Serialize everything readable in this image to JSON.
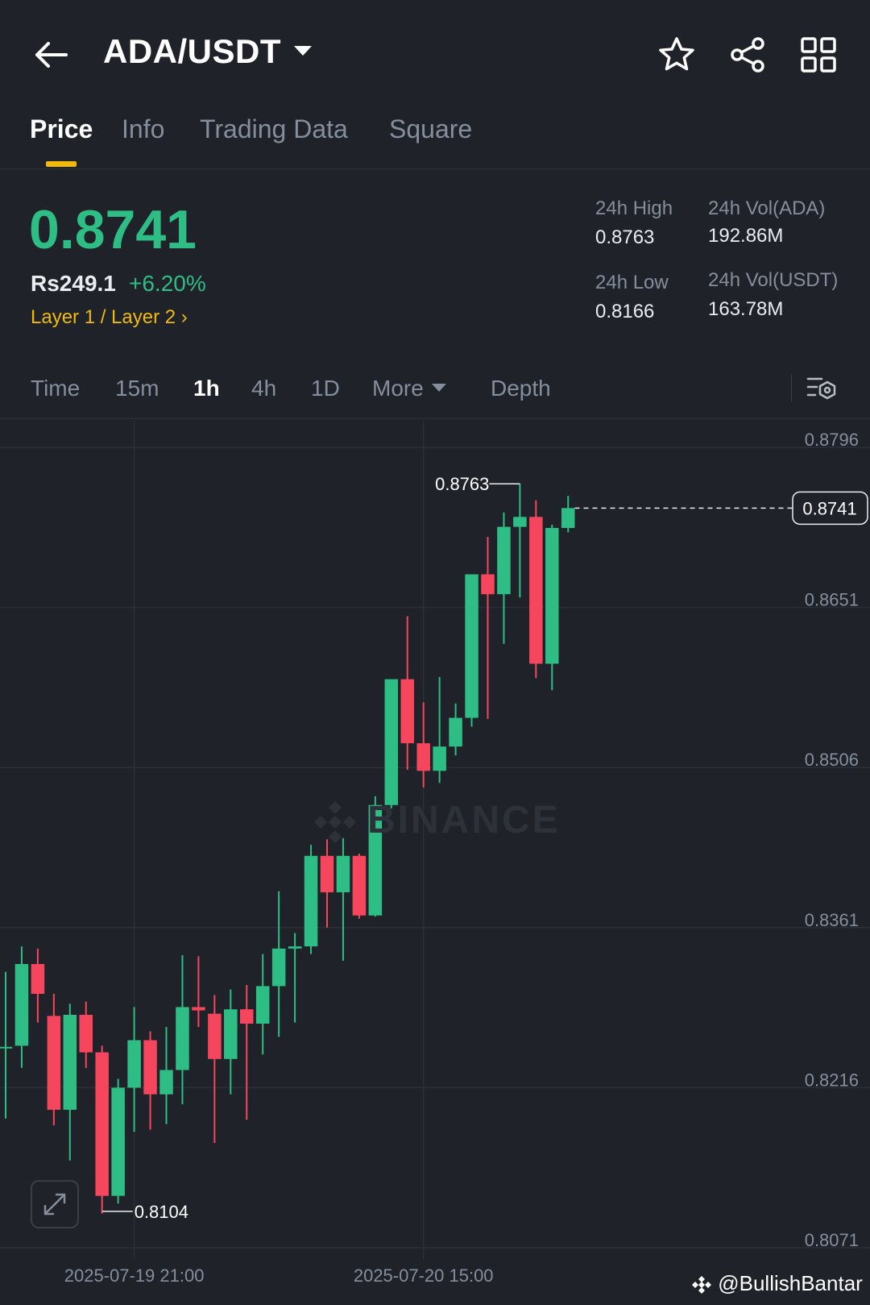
{
  "header": {
    "pair": "ADA/USDT",
    "icons": {
      "back": "arrow-left-icon",
      "favorite": "star-icon",
      "share": "share-icon",
      "menu": "grid-icon"
    }
  },
  "tabs": [
    {
      "label": "Price",
      "active": true
    },
    {
      "label": "Info",
      "active": false
    },
    {
      "label": "Trading Data",
      "active": false
    },
    {
      "label": "Square",
      "active": false
    }
  ],
  "ticker": {
    "last_price": "0.8741",
    "fiat_price": "Rs249.1",
    "change_pct": "+6.20%",
    "tag": "Layer 1 / Layer 2",
    "high_label": "24h High",
    "high_value": "0.8763",
    "low_label": "24h Low",
    "low_value": "0.8166",
    "vol_base_label": "24h Vol(ADA)",
    "vol_base_value": "192.86M",
    "vol_quote_label": "24h Vol(USDT)",
    "vol_quote_value": "163.78M"
  },
  "intervals": {
    "items": [
      {
        "label": "Time",
        "active": false
      },
      {
        "label": "15m",
        "active": false
      },
      {
        "label": "1h",
        "active": true
      },
      {
        "label": "4h",
        "active": false
      },
      {
        "label": "1D",
        "active": false
      }
    ],
    "more_label": "More",
    "depth_label": "Depth"
  },
  "colors": {
    "up": "#2ebd85",
    "down": "#f6465d",
    "accent": "#f0b90b",
    "background": "#1f2329"
  },
  "chart_data": {
    "type": "candlestick",
    "interval": "1h",
    "y_ticks": [
      0.8796,
      0.8651,
      0.8506,
      0.8361,
      0.8216,
      0.8071
    ],
    "ylim": [
      0.8071,
      0.8796
    ],
    "x_ticks": [
      "2025-07-19 21:00",
      "2025-07-20 15:00"
    ],
    "last_price_label": "0.8741",
    "high_marker": {
      "label": "0.8763",
      "value": 0.8763
    },
    "low_marker": {
      "label": "0.8104",
      "value": 0.8104
    },
    "watermark": "BINANCE",
    "candles": [
      {
        "o": 0.8253,
        "h": 0.8321,
        "l": 0.8188,
        "c": 0.8253
      },
      {
        "o": 0.8254,
        "h": 0.8344,
        "l": 0.8234,
        "c": 0.8328
      },
      {
        "o": 0.8328,
        "h": 0.8342,
        "l": 0.8275,
        "c": 0.8301
      },
      {
        "o": 0.8281,
        "h": 0.8301,
        "l": 0.8182,
        "c": 0.8196
      },
      {
        "o": 0.8196,
        "h": 0.8292,
        "l": 0.815,
        "c": 0.8282
      },
      {
        "o": 0.8282,
        "h": 0.8294,
        "l": 0.8234,
        "c": 0.8248
      },
      {
        "o": 0.8248,
        "h": 0.8254,
        "l": 0.8102,
        "c": 0.8118
      },
      {
        "o": 0.8118,
        "h": 0.8224,
        "l": 0.8111,
        "c": 0.8216
      },
      {
        "o": 0.8216,
        "h": 0.8289,
        "l": 0.8176,
        "c": 0.8259
      },
      {
        "o": 0.8259,
        "h": 0.8267,
        "l": 0.8178,
        "c": 0.821
      },
      {
        "o": 0.821,
        "h": 0.8271,
        "l": 0.8183,
        "c": 0.8232
      },
      {
        "o": 0.8232,
        "h": 0.8336,
        "l": 0.8201,
        "c": 0.8289
      },
      {
        "o": 0.8289,
        "h": 0.8335,
        "l": 0.8271,
        "c": 0.8286
      },
      {
        "o": 0.8283,
        "h": 0.83,
        "l": 0.8166,
        "c": 0.8242
      },
      {
        "o": 0.8242,
        "h": 0.8305,
        "l": 0.821,
        "c": 0.8287
      },
      {
        "o": 0.8287,
        "h": 0.8309,
        "l": 0.8187,
        "c": 0.8274
      },
      {
        "o": 0.8274,
        "h": 0.8337,
        "l": 0.8246,
        "c": 0.8308
      },
      {
        "o": 0.8308,
        "h": 0.8394,
        "l": 0.8262,
        "c": 0.8342
      },
      {
        "o": 0.8342,
        "h": 0.8356,
        "l": 0.8275,
        "c": 0.8344
      },
      {
        "o": 0.8344,
        "h": 0.8436,
        "l": 0.8337,
        "c": 0.8426
      },
      {
        "o": 0.8426,
        "h": 0.8441,
        "l": 0.8361,
        "c": 0.8393
      },
      {
        "o": 0.8393,
        "h": 0.8442,
        "l": 0.8331,
        "c": 0.8426
      },
      {
        "o": 0.8426,
        "h": 0.8428,
        "l": 0.8369,
        "c": 0.8372
      },
      {
        "o": 0.8372,
        "h": 0.848,
        "l": 0.8371,
        "c": 0.8472
      },
      {
        "o": 0.8472,
        "h": 0.8585,
        "l": 0.8469,
        "c": 0.8586
      },
      {
        "o": 0.8586,
        "h": 0.8643,
        "l": 0.8504,
        "c": 0.8528
      },
      {
        "o": 0.8528,
        "h": 0.8565,
        "l": 0.8488,
        "c": 0.8503
      },
      {
        "o": 0.8503,
        "h": 0.8588,
        "l": 0.8492,
        "c": 0.8525
      },
      {
        "o": 0.8525,
        "h": 0.8564,
        "l": 0.8517,
        "c": 0.8551
      },
      {
        "o": 0.8551,
        "h": 0.8675,
        "l": 0.8543,
        "c": 0.8681
      },
      {
        "o": 0.8681,
        "h": 0.8715,
        "l": 0.855,
        "c": 0.8663
      },
      {
        "o": 0.8663,
        "h": 0.8737,
        "l": 0.8618,
        "c": 0.8724
      },
      {
        "o": 0.8724,
        "h": 0.8763,
        "l": 0.866,
        "c": 0.8733
      },
      {
        "o": 0.8733,
        "h": 0.8748,
        "l": 0.8587,
        "c": 0.86
      },
      {
        "o": 0.86,
        "h": 0.8726,
        "l": 0.8576,
        "c": 0.8723
      },
      {
        "o": 0.8723,
        "h": 0.8752,
        "l": 0.8719,
        "c": 0.8741
      }
    ]
  },
  "footer": {
    "credit": "@BullishBantar"
  }
}
